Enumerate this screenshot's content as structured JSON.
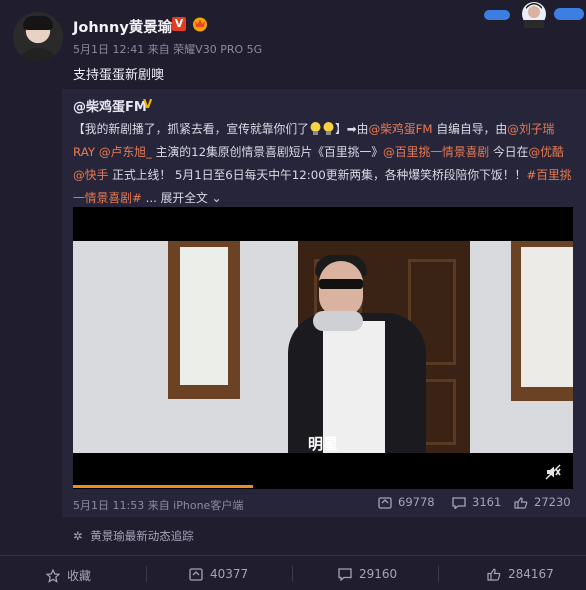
{
  "post": {
    "username": "Johnny黄景瑜",
    "verified_badge": "V",
    "meta": "5月1日 12:41 来自 荣耀V30 PRO 5G",
    "text": "支持蛋蛋新剧噢"
  },
  "repost": {
    "author": "@柴鸡蛋FM",
    "text_segments": [
      {
        "t": "【我的新剧播了，抓紧去看，宣传就靠你们了",
        "link": false
      },
      {
        "t": "】➡由",
        "link": false,
        "emoji_before": true
      },
      {
        "t": "@柴鸡蛋FM",
        "link": true
      },
      {
        "t": " 自编自导，由",
        "link": false
      },
      {
        "t": "@刘子瑞RAY",
        "link": true
      },
      {
        "t": " ",
        "link": false
      },
      {
        "t": "@卢东旭_",
        "link": true
      },
      {
        "t": " 主演的12集原创情景喜剧短片《百里挑一》",
        "link": false
      },
      {
        "t": "@百里挑一情景喜剧",
        "link": true
      },
      {
        "t": " 今日在",
        "link": false
      },
      {
        "t": "@优酷",
        "link": true
      },
      {
        "t": " ",
        "link": false
      },
      {
        "t": "@快手",
        "link": true
      },
      {
        "t": " 正式上线！ 5月1日至6日每天中午12:00更新两集，各种爆笑桥段陪你下饭！！",
        "link": false
      },
      {
        "t": "#百里挑一情景喜剧#",
        "link": true
      },
      {
        "t": " ... ",
        "link": false
      },
      {
        "t": "展开全文",
        "link": false
      },
      {
        "t": " ⌄",
        "link": false
      }
    ],
    "video": {
      "subtitle": "明星",
      "progress": 0.36
    },
    "meta": "5月1日 11:53 来自 iPhone客户端",
    "stats": {
      "reposts": "69778",
      "comments": "3161",
      "likes": "27230"
    }
  },
  "follow_link": "黄景瑜最新动态追踪",
  "actions": {
    "favorite": "收藏",
    "repost": "40377",
    "comment": "29160",
    "like": "284167"
  }
}
